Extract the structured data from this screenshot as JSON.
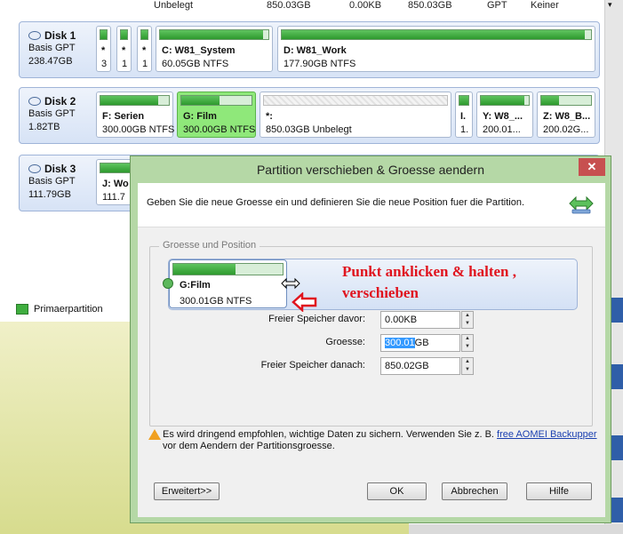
{
  "background": {
    "top_row": {
      "col_a": "Unbelegt",
      "col_b": "850.03GB",
      "col_c": "0.00KB",
      "col_d": "850.03GB",
      "col_e": "GPT",
      "col_f": "Keiner"
    },
    "disks": [
      {
        "name": "Disk 1",
        "type": "Basis GPT",
        "size": "238.47GB",
        "partitions": [
          {
            "name": "*",
            "size": "3"
          },
          {
            "name": "*",
            "size": "1"
          },
          {
            "name": "*",
            "size": "1"
          },
          {
            "name": "C: W81_System",
            "size": "60.05GB NTFS",
            "fill": 0.95
          },
          {
            "name": "D: W81_Work",
            "size": "177.90GB NTFS",
            "fill": 0.98
          }
        ]
      },
      {
        "name": "Disk 2",
        "type": "Basis GPT",
        "size": "1.82TB",
        "partitions": [
          {
            "name": "F: Serien",
            "size": "300.00GB NTFS",
            "fill": 0.85
          },
          {
            "name": "G: Film",
            "size": "300.00GB NTFS",
            "fill": 0.55
          },
          {
            "name": "*:",
            "size": "850.03GB Unbelegt"
          },
          {
            "name": "I.",
            "size": "1."
          },
          {
            "name": "Y: W8_...",
            "size": "200.01...",
            "fill": 0.9
          },
          {
            "name": "Z: W8_B...",
            "size": "200.02G...",
            "fill": 0.35
          }
        ]
      },
      {
        "name": "Disk 3",
        "type": "Basis GPT",
        "size": "111.79GB",
        "partitions": [
          {
            "name": "J: Wo",
            "size": "111.7"
          }
        ]
      }
    ],
    "legend": "Primaerpartition"
  },
  "dialog": {
    "title": "Partition verschieben & Groesse aendern",
    "close": "✕",
    "header_text": "Geben Sie die neue Groesse ein und definieren Sie die neue Position fuer die Partition.",
    "group_label": "Groesse und Position",
    "partition": {
      "name": "G:Film",
      "size": "300.01GB NTFS",
      "fill": 0.57
    },
    "annotation_line1": "Punkt anklicken & halten ,",
    "annotation_line2": "verschieben",
    "fields": [
      {
        "label": "Freier Speicher davor:",
        "value": "0.00KB"
      },
      {
        "label": "Groesse:",
        "value_selected": "300.01",
        "value_rest": "GB"
      },
      {
        "label": "Freier Speicher danach:",
        "value": "850.02GB"
      }
    ],
    "warning_text": "Es wird dringend empfohlen, wichtige Daten zu sichern. Verwenden Sie z. B.",
    "warning_link": "free AOMEI Backupper",
    "warning_text2": "vor dem Aendern der Partitionsgroesse.",
    "buttons": {
      "advanced": "Erweitert>>",
      "ok": "OK",
      "cancel": "Abbrechen",
      "help": "Hilfe"
    },
    "colors": {
      "title_bg": "#b5d8a6",
      "annotation": "#e0141e",
      "close": "#c75050"
    }
  }
}
